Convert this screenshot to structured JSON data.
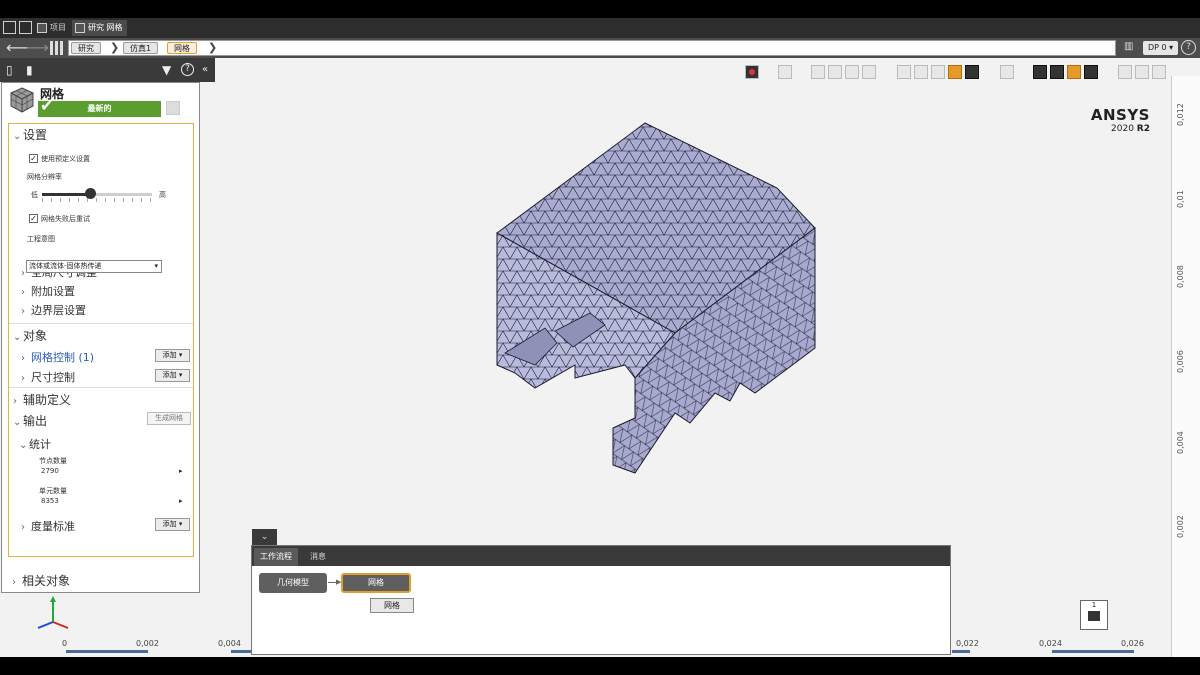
{
  "topbar": {
    "tab_project": "项目",
    "tab_study": "研究 网格"
  },
  "nav": {
    "breadcrumbs": [
      "研究",
      "仿真1",
      "网格"
    ],
    "dp_label": "DP 0 ▾",
    "help": "?"
  },
  "panel": {
    "title": "网格",
    "status": "最新的",
    "settings": {
      "header": "设置",
      "use_preset": "使用预定义设置",
      "resolution_label": "网格分辨率",
      "resolution_low": "低",
      "resolution_high": "高",
      "resolution_value": 0.44,
      "retry_label": "网格失败后重试",
      "intent_label": "工程意图",
      "intent_value": "流体或流体-固体热传递",
      "global_sizing": "全局尺寸调整",
      "additional": "附加设置",
      "boundary": "边界层设置"
    },
    "objects": {
      "header": "对象",
      "mesh_control": "网格控制 (1)",
      "size_control": "尺寸控制",
      "add_label": "添加 ▾"
    },
    "aux_def": "辅助定义",
    "output": {
      "header": "输出",
      "generate_btn": "生成网格",
      "stats_header": "统计",
      "node_count_label": "节点数量",
      "node_count": "2790",
      "element_count_label": "单元数量",
      "element_count": "8353",
      "metric_label": "度量标准",
      "add_label": "添加 ▾"
    },
    "related": "相关对象"
  },
  "viewport": {
    "logo": "ANSYS",
    "version_year": "2020",
    "version_r": "R2",
    "mesh_fill": "#a9abd0",
    "mesh_edge": "#1a1a2e",
    "ruler_h": [
      "0",
      "0,002",
      "0,004",
      "0,022",
      "0,024",
      "0,026"
    ],
    "ruler_v": [
      "0,012",
      "0,01",
      "0,008",
      "0,006",
      "0,004",
      "0,002"
    ],
    "view_cube_label": "1"
  },
  "workflow": {
    "tab_workflow": "工作流程",
    "tab_messages": "消息",
    "node_geometry": "几何模型",
    "node_mesh": "网格",
    "tooltip": "网格"
  },
  "colors": {
    "accent": "#e0a030",
    "status_green": "#5a9e2f"
  }
}
